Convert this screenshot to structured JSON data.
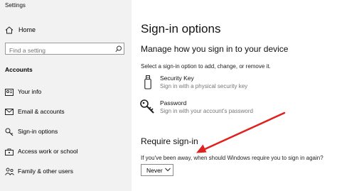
{
  "window": {
    "title": "Settings"
  },
  "sidebar": {
    "home_label": "Home",
    "search_placeholder": "Find a setting",
    "section_title": "Accounts",
    "items": [
      {
        "label": "Your info",
        "icon": "person-card-icon"
      },
      {
        "label": "Email & accounts",
        "icon": "mail-icon"
      },
      {
        "label": "Sign-in options",
        "icon": "key-icon"
      },
      {
        "label": "Access work or school",
        "icon": "briefcase-icon"
      },
      {
        "label": "Family & other users",
        "icon": "family-icon"
      }
    ]
  },
  "main": {
    "title": "Sign-in options",
    "manage_heading": "Manage how you sign in to your device",
    "manage_desc": "Select a sign-in option to add, change, or remove it.",
    "options": [
      {
        "title": "Security Key",
        "subtitle": "Sign in with a physical security key",
        "icon": "usb-key-icon"
      },
      {
        "title": "Password",
        "subtitle": "Sign in with your account's password",
        "icon": "key-icon"
      }
    ],
    "require_heading": "Require sign-in",
    "require_question": "If you've been away, when should Windows require you to sign in again?",
    "require_value": "Never"
  },
  "annotation": {
    "arrow_color": "#e0201e"
  }
}
